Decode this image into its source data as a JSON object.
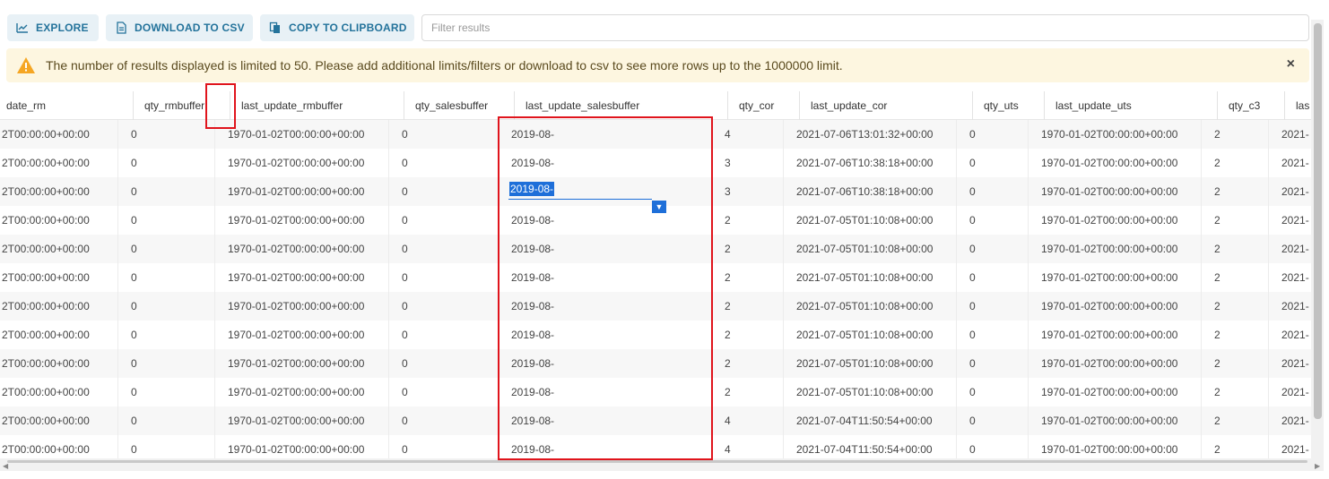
{
  "toolbar": {
    "explore_label": "EXPLORE",
    "download_label": "DOWNLOAD TO CSV",
    "copy_label": "COPY TO CLIPBOARD",
    "filter_placeholder": "Filter results"
  },
  "alert": {
    "message": "The number of results displayed is limited to 50. Please add additional limits/filters or download to csv to see more rows up to the 1000000 limit.",
    "close_label": "×"
  },
  "columns": [
    "date_rm",
    "qty_rmbuffer",
    "last_update_rmbuffer",
    "qty_salesbuffer",
    "last_update_salesbuffer",
    "qty_cor",
    "last_update_cor",
    "qty_uts",
    "last_update_uts",
    "qty_c3",
    "las"
  ],
  "rows": [
    [
      "2T00:00:00+00:00",
      "0",
      "1970-01-02T00:00:00+00:00",
      "0",
      "2019-08-",
      "4",
      "2021-07-06T13:01:32+00:00",
      "0",
      "1970-01-02T00:00:00+00:00",
      "2",
      "2021-"
    ],
    [
      "2T00:00:00+00:00",
      "0",
      "1970-01-02T00:00:00+00:00",
      "0",
      "2019-08-",
      "3",
      "2021-07-06T10:38:18+00:00",
      "0",
      "1970-01-02T00:00:00+00:00",
      "2",
      "2021-"
    ],
    [
      "2T00:00:00+00:00",
      "0",
      "1970-01-02T00:00:00+00:00",
      "0",
      "2019-08-",
      "3",
      "2021-07-06T10:38:18+00:00",
      "0",
      "1970-01-02T00:00:00+00:00",
      "2",
      "2021-"
    ],
    [
      "2T00:00:00+00:00",
      "0",
      "1970-01-02T00:00:00+00:00",
      "0",
      "2019-08-",
      "2",
      "2021-07-05T01:10:08+00:00",
      "0",
      "1970-01-02T00:00:00+00:00",
      "2",
      "2021-"
    ],
    [
      "2T00:00:00+00:00",
      "0",
      "1970-01-02T00:00:00+00:00",
      "0",
      "2019-08-",
      "2",
      "2021-07-05T01:10:08+00:00",
      "0",
      "1970-01-02T00:00:00+00:00",
      "2",
      "2021-"
    ],
    [
      "2T00:00:00+00:00",
      "0",
      "1970-01-02T00:00:00+00:00",
      "0",
      "2019-08-",
      "2",
      "2021-07-05T01:10:08+00:00",
      "0",
      "1970-01-02T00:00:00+00:00",
      "2",
      "2021-"
    ],
    [
      "2T00:00:00+00:00",
      "0",
      "1970-01-02T00:00:00+00:00",
      "0",
      "2019-08-",
      "2",
      "2021-07-05T01:10:08+00:00",
      "0",
      "1970-01-02T00:00:00+00:00",
      "2",
      "2021-"
    ],
    [
      "2T00:00:00+00:00",
      "0",
      "1970-01-02T00:00:00+00:00",
      "0",
      "2019-08-",
      "2",
      "2021-07-05T01:10:08+00:00",
      "0",
      "1970-01-02T00:00:00+00:00",
      "2",
      "2021-"
    ],
    [
      "2T00:00:00+00:00",
      "0",
      "1970-01-02T00:00:00+00:00",
      "0",
      "2019-08-",
      "2",
      "2021-07-05T01:10:08+00:00",
      "0",
      "1970-01-02T00:00:00+00:00",
      "2",
      "2021-"
    ],
    [
      "2T00:00:00+00:00",
      "0",
      "1970-01-02T00:00:00+00:00",
      "0",
      "2019-08-",
      "2",
      "2021-07-05T01:10:08+00:00",
      "0",
      "1970-01-02T00:00:00+00:00",
      "2",
      "2021-"
    ],
    [
      "2T00:00:00+00:00",
      "0",
      "1970-01-02T00:00:00+00:00",
      "0",
      "2019-08-",
      "4",
      "2021-07-04T11:50:54+00:00",
      "0",
      "1970-01-02T00:00:00+00:00",
      "2",
      "2021-"
    ],
    [
      "2T00:00:00+00:00",
      "0",
      "1970-01-02T00:00:00+00:00",
      "0",
      "2019-08-",
      "4",
      "2021-07-04T11:50:54+00:00",
      "0",
      "1970-01-02T00:00:00+00:00",
      "2",
      "2021-"
    ]
  ],
  "editing": {
    "row": 2,
    "col": 4
  },
  "colors": {
    "accent": "#24739b",
    "selection": "#1e6fd9",
    "highlight": "#e0141c",
    "alert_bg": "#fdf6e0"
  },
  "icons": {
    "explore": "line-chart-icon",
    "download": "file-icon",
    "copy": "copy-icon",
    "warning": "warning-icon",
    "close": "close-icon"
  }
}
